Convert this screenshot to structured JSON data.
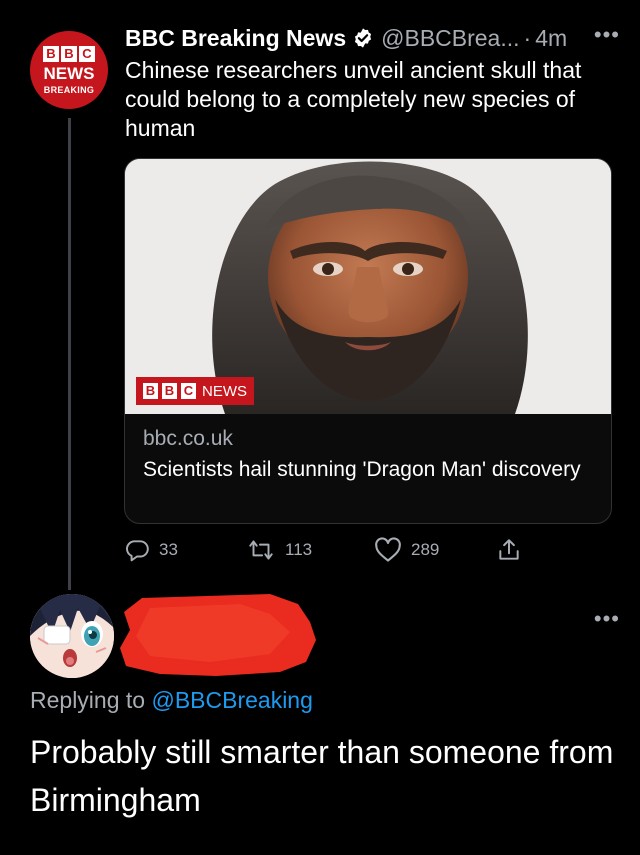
{
  "tweet": {
    "author": {
      "name": "BBC Breaking News",
      "handle": "@BBCBrea...",
      "avatar_logo_letters": [
        "B",
        "B",
        "C"
      ],
      "avatar_line1": "NEWS",
      "avatar_line2": "BREAKING",
      "verified": true
    },
    "time_sep": "·",
    "time": "4m",
    "more_icon": "more-horizontal-icon",
    "text": "Chinese researchers unveil ancient skull that could belong to a completely new species of human",
    "card": {
      "image_subject": "reconstruction of an ancient human face",
      "tag_letters": [
        "B",
        "B",
        "C"
      ],
      "tag_label": "NEWS",
      "domain": "bbc.co.uk",
      "title": "Scientists hail stunning 'Dragon Man' discovery"
    },
    "actions": {
      "replies": "33",
      "retweets": "113",
      "likes": "289",
      "icons": [
        "reply-icon",
        "retweet-icon",
        "like-icon",
        "share-icon"
      ]
    }
  },
  "reply": {
    "author_redacted": true,
    "replying_prefix": "Replying to",
    "replying_handle": "@BBCBreaking",
    "text": "Probably still smarter than someone from Birmingham",
    "more_icon": "more-horizontal-icon"
  },
  "colors": {
    "background": "#000000",
    "primary_text": "#ffffff",
    "secondary_text": "#a7adb3",
    "link_blue": "#1d9bf0",
    "bbc_red": "#c4161c",
    "redaction_red": "#ea2b1f",
    "divider": "#2f3336"
  }
}
